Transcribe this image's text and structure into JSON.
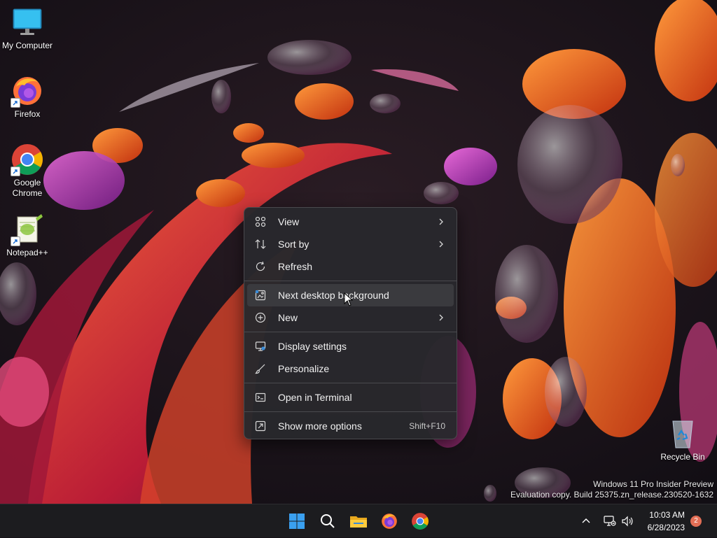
{
  "desktop_icons": [
    {
      "label": "My Computer"
    },
    {
      "label": "Firefox"
    },
    {
      "label": "Google Chrome"
    },
    {
      "label": "Notepad++"
    },
    {
      "label": "Recycle Bin"
    }
  ],
  "context_menu": {
    "items": [
      {
        "label": "View",
        "icon": "grid-icon",
        "submenu": true
      },
      {
        "label": "Sort by",
        "icon": "sort-icon",
        "submenu": true
      },
      {
        "label": "Refresh",
        "icon": "refresh-icon"
      },
      {
        "label": "Next desktop background",
        "icon": "next-background-icon",
        "hovered": true
      },
      {
        "label": "New",
        "icon": "plus-circle-icon",
        "submenu": true
      },
      {
        "label": "Display settings",
        "icon": "display-icon"
      },
      {
        "label": "Personalize",
        "icon": "brush-icon"
      },
      {
        "label": "Open in Terminal",
        "icon": "terminal-icon"
      },
      {
        "label": "Show more options",
        "icon": "more-options-icon",
        "shortcut": "Shift+F10"
      }
    ]
  },
  "watermark": {
    "line1": "Windows 11 Pro Insider Preview",
    "line2": "Evaluation copy. Build 25375.zn_release.230520-1632"
  },
  "taskbar": {
    "pinned": [
      "start-icon",
      "search-icon",
      "file-explorer-icon",
      "firefox-icon",
      "chrome-icon"
    ],
    "time": "10:03 AM",
    "date": "6/28/2023",
    "notification_count": "2"
  }
}
